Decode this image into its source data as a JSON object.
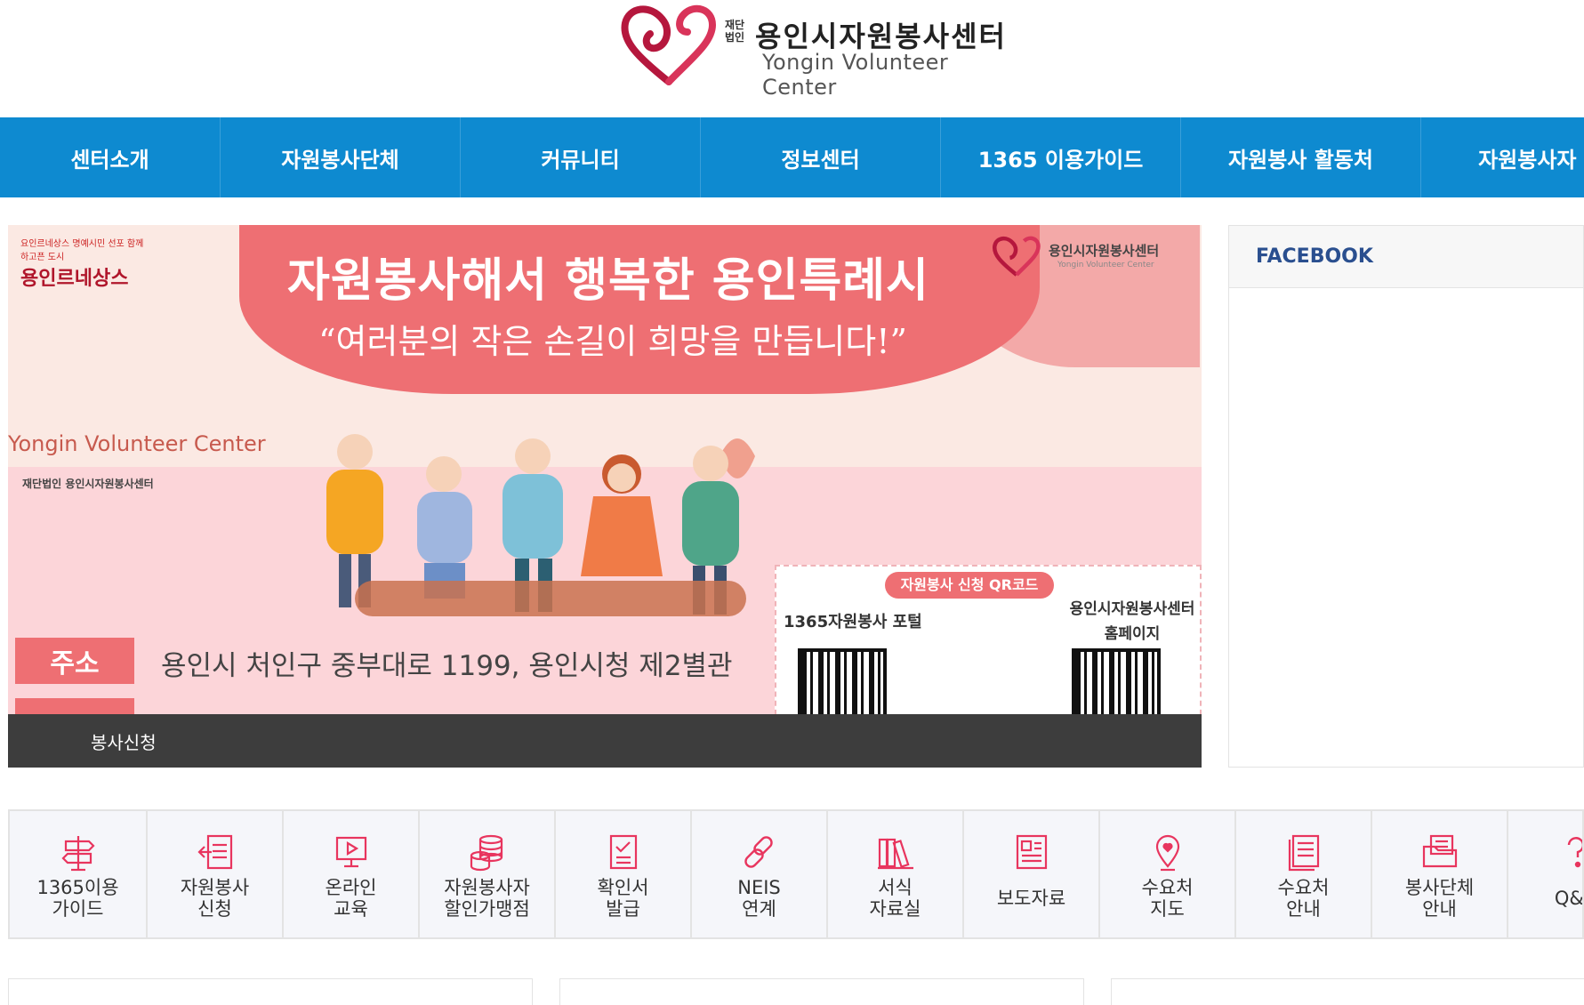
{
  "header": {
    "logo_corp": "재단 법인",
    "logo_title": "용인시자원봉사센터",
    "logo_subtitle": "Yongin Volunteer Center"
  },
  "nav": {
    "items": [
      {
        "label": "센터소개"
      },
      {
        "label": "자원봉사단체"
      },
      {
        "label": "커뮤니티"
      },
      {
        "label": "정보센터"
      },
      {
        "label": "1365 이용가이드"
      },
      {
        "label": "자원봉사 활동처"
      },
      {
        "label": "자원봉사자 인"
      }
    ]
  },
  "banner": {
    "badge_small": "요인르네상스 명예시민 선포 함께 하고픈 도시",
    "badge_main": "용인르네상스",
    "logo_text": "용인시자원봉사센터",
    "logo_sub": "Yongin Volunteer Center",
    "title": "자원봉사해서 행복한 용인특례시",
    "subtitle": "“여러분의 작은 손길이 희망을 만듭니다!”",
    "en_label": "Yongin Volunteer Center",
    "corp_label": "재단법인 용인시자원봉사센터",
    "qr_title": "자원봉사 신청 QR코드",
    "qr_left_label": "1365자원봉사 포털",
    "qr_right_label_1": "용인시자원봉사센터",
    "qr_right_label_2": "홈페이지",
    "address_tag": "주소",
    "address": "용인시 처인구 중부대로 1199, 용인시청 제2별관",
    "caption": "봉사신청"
  },
  "facebook": {
    "title": "FACEBOOK"
  },
  "quick_menu": [
    {
      "label": "1365이용\n가이드",
      "icon": "signpost-icon"
    },
    {
      "label": "자원봉사\n신청",
      "icon": "document-arrow-icon"
    },
    {
      "label": "온라인\n교육",
      "icon": "monitor-play-icon"
    },
    {
      "label": "자원봉사자\n할인가맹점",
      "icon": "coins-icon"
    },
    {
      "label": "확인서\n발급",
      "icon": "checklist-icon"
    },
    {
      "label": "NEIS\n연계",
      "icon": "link-icon"
    },
    {
      "label": "서식\n자료실",
      "icon": "books-icon"
    },
    {
      "label": "보도자료",
      "icon": "newspaper-icon"
    },
    {
      "label": "수요처\n지도",
      "icon": "map-pin-icon"
    },
    {
      "label": "수요처\n안내",
      "icon": "list-doc-icon"
    },
    {
      "label": "봉사단체\n안내",
      "icon": "folder-icon"
    },
    {
      "label": "Q&A",
      "icon": "question-icon"
    }
  ],
  "colors": {
    "nav_bg": "#0e8ad0",
    "accent_pink": "#e8355e",
    "banner_red": "#ee6f73",
    "facebook_title": "#2a4f8f"
  }
}
